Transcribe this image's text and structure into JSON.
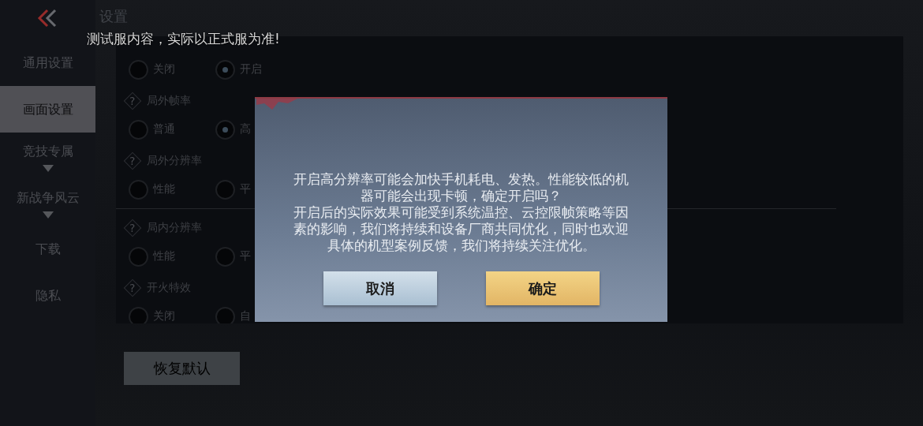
{
  "back": {
    "kind": "chevron"
  },
  "title": "设置",
  "notice": "测试服内容，实际以正式服为准!",
  "sidebar": {
    "items": [
      {
        "label": "通用设置",
        "selected": false,
        "expandable": false
      },
      {
        "label": "画面设置",
        "selected": true,
        "expandable": false
      },
      {
        "label": "竞技专属",
        "selected": false,
        "expandable": true
      },
      {
        "label": "新战争风云",
        "selected": false,
        "expandable": true
      },
      {
        "label": "下载",
        "selected": false,
        "expandable": false
      },
      {
        "label": "隐私",
        "selected": false,
        "expandable": false
      }
    ]
  },
  "settings": [
    {
      "options": [
        {
          "label": "关闭",
          "selected": false
        },
        {
          "label": "开启",
          "selected": true
        }
      ]
    },
    {
      "help": "?",
      "label": "局外帧率",
      "options": [
        {
          "label": "普通",
          "selected": false
        },
        {
          "label": "高",
          "selected": true
        }
      ]
    },
    {
      "help": "?",
      "label": "局外分辨率",
      "options": [
        {
          "label": "性能",
          "selected": false
        },
        {
          "label": "平",
          "selected": false
        }
      ]
    },
    {
      "help": "?",
      "label": "局内分辨率",
      "options": [
        {
          "label": "性能",
          "selected": false
        },
        {
          "label": "平",
          "selected": false
        }
      ]
    },
    {
      "help": "?",
      "label": "开火特效",
      "options": [
        {
          "label": "关闭",
          "selected": false
        },
        {
          "label": "自",
          "selected": false
        }
      ]
    }
  ],
  "restore_button": "恢复默认",
  "dialog": {
    "paragraphs": [
      "开启高分辨率可能会加快手机耗电、发热。性能较低的机器可能会出现卡顿，确定开启吗？",
      "开启后的实际效果可能受到系统温控、云控限帧策略等因素的影响，我们将持续和设备厂商共同优化，同时也欢迎具体的机型案例反馈，我们将持续关注优化。"
    ],
    "buttons": [
      {
        "label": "取消",
        "kind": "secondary"
      },
      {
        "label": "确定",
        "kind": "primary"
      }
    ]
  }
}
